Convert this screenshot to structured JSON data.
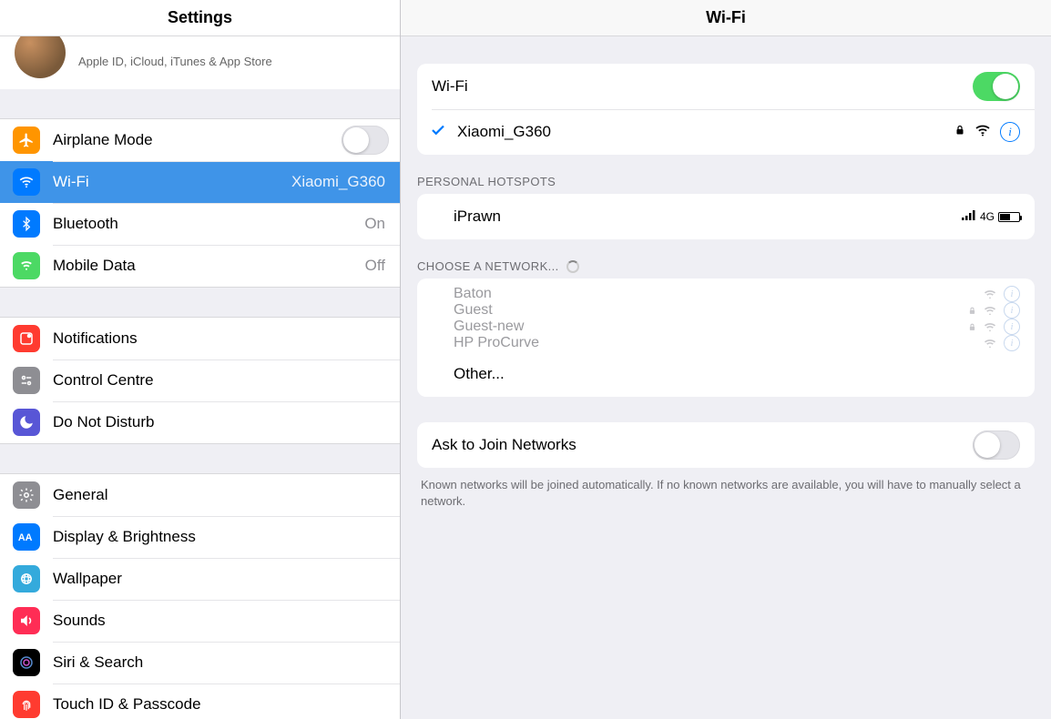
{
  "sidebar": {
    "title": "Settings",
    "account": {
      "subtitle": "Apple ID, iCloud, iTunes & App Store"
    },
    "group1": {
      "airplane": {
        "label": "Airplane Mode",
        "on": false
      },
      "wifi": {
        "label": "Wi-Fi",
        "value": "Xiaomi_G360",
        "selected": true
      },
      "bluetooth": {
        "label": "Bluetooth",
        "value": "On"
      },
      "mobile": {
        "label": "Mobile Data",
        "value": "Off"
      }
    },
    "group2": {
      "notifications": {
        "label": "Notifications"
      },
      "control": {
        "label": "Control Centre"
      },
      "dnd": {
        "label": "Do Not Disturb"
      }
    },
    "group3": {
      "general": {
        "label": "General"
      },
      "display": {
        "label": "Display & Brightness"
      },
      "wallpaper": {
        "label": "Wallpaper"
      },
      "sounds": {
        "label": "Sounds"
      },
      "siri": {
        "label": "Siri & Search"
      },
      "touchid": {
        "label": "Touch ID & Passcode"
      }
    }
  },
  "detail": {
    "title": "Wi-Fi",
    "wifi_toggle": {
      "label": "Wi-Fi",
      "on": true
    },
    "connected": {
      "name": "Xiaomi_G360",
      "locked": true
    },
    "hotspots_header": "PERSONAL HOTSPOTS",
    "hotspots": [
      {
        "name": "iPrawn",
        "signal": "4G"
      }
    ],
    "choose_header": "CHOOSE A NETWORK...",
    "networks": [
      {
        "name": "Baton",
        "locked": false
      },
      {
        "name": "Guest",
        "locked": true
      },
      {
        "name": "Guest-new",
        "locked": true
      },
      {
        "name": "HP ProCurve",
        "locked": false
      }
    ],
    "other_label": "Other...",
    "ask_join": {
      "label": "Ask to Join Networks",
      "on": false
    },
    "ask_help": "Known networks will be joined automatically. If no known networks are available, you will have to manually select a network."
  }
}
